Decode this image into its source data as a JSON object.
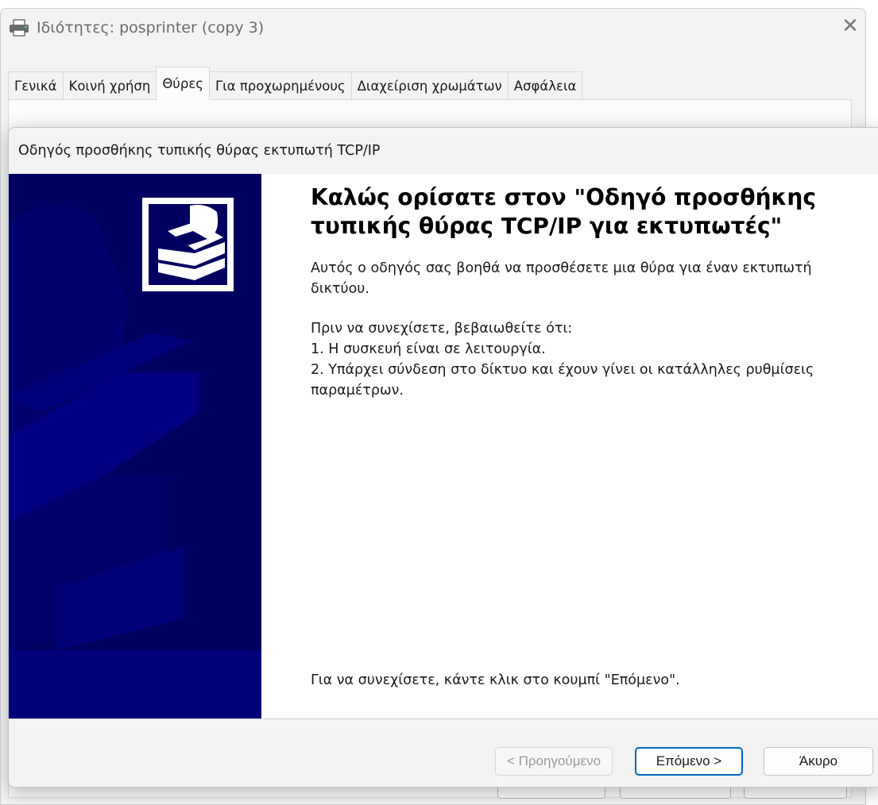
{
  "properties_window": {
    "title": "Ιδιότητες: posprinter (copy 3)",
    "close_glyph": "✕",
    "tabs": [
      {
        "label": "Γενικά",
        "active": false
      },
      {
        "label": "Κοινή χρήση",
        "active": false
      },
      {
        "label": "Θύρες",
        "active": true
      },
      {
        "label": "Για προχωρημένους",
        "active": false
      },
      {
        "label": "Διαχείριση χρωμάτων",
        "active": false
      },
      {
        "label": "Ασφάλεια",
        "active": false
      }
    ]
  },
  "wizard": {
    "title": "Οδηγός προσθήκης τυπικής θύρας εκτυπωτή TCP/IP",
    "heading": "Καλώς ορίσατε στον \"Οδηγό προσθήκης τυπικής θύρας TCP/IP για εκτυπωτές\"",
    "intro": "Αυτός ο οδηγός σας βοηθά να προσθέσετε μια θύρα για έναν εκτυπωτή δικτύου.",
    "before_title": "Πριν να συνεχίσετε, βεβαιωθείτε ότι:",
    "requirements": [
      "1. Η συσκευή είναι σε λειτουργία.",
      "2. Υπάρχει σύνδεση στο δίκτυο και έχουν γίνει οι κατάλληλες ρυθμίσεις παραμέτρων."
    ],
    "continue_hint": "Για να συνεχίσετε, κάντε κλικ στο κουμπί \"Επόμενο\".",
    "buttons": {
      "back": "< Προηγούμενο",
      "next": "Επόμενο >",
      "cancel": "Άκυρο"
    },
    "colors": {
      "art_background": "#000060",
      "art_band": "#00007a",
      "primary_border": "#0067c0"
    }
  }
}
